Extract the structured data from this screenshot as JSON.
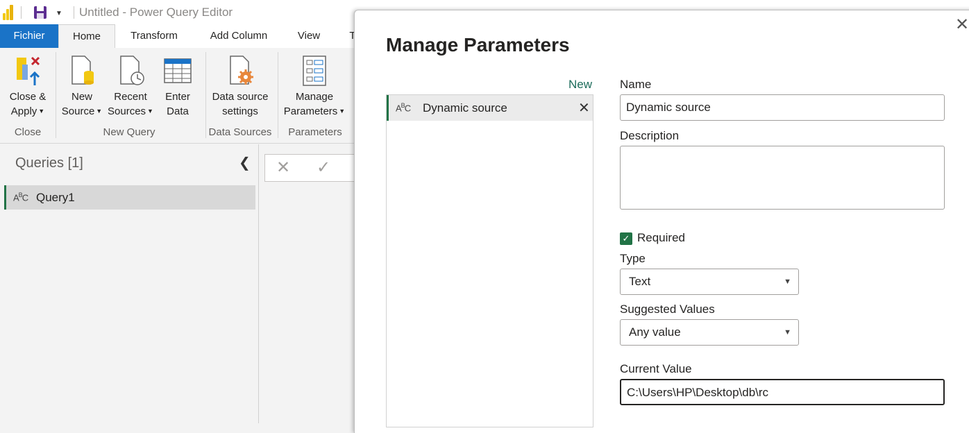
{
  "window": {
    "title": "Untitled - Power Query Editor"
  },
  "tabs": [
    {
      "label": "Fichier"
    },
    {
      "label": "Home"
    },
    {
      "label": "Transform"
    },
    {
      "label": "Add Column"
    },
    {
      "label": "View"
    },
    {
      "label": "T"
    }
  ],
  "ribbon": {
    "close_apply": {
      "line1": "Close &",
      "line2": "Apply"
    },
    "new_source": {
      "line1": "New",
      "line2": "Source"
    },
    "recent_sources": {
      "line1": "Recent",
      "line2": "Sources"
    },
    "enter_data": {
      "line1": "Enter",
      "line2": "Data"
    },
    "data_source_settings": {
      "line1": "Data source",
      "line2": "settings"
    },
    "manage_parameters": {
      "line1": "Manage",
      "line2": "Parameters"
    },
    "groups": {
      "close": "Close",
      "new_query": "New Query",
      "data_sources": "Data Sources",
      "parameters": "Parameters"
    }
  },
  "queries": {
    "title": "Queries [1]",
    "items": [
      {
        "name": "Query1",
        "type_icon": "abc-text-icon"
      }
    ]
  },
  "dialog": {
    "title": "Manage Parameters",
    "new_label": "New",
    "parameters": [
      {
        "name": "Dynamic source",
        "type_icon": "abc-text-icon"
      }
    ],
    "name_label": "Name",
    "name_value": "Dynamic source",
    "description_label": "Description",
    "description_value": "",
    "required_label": "Required",
    "required_checked": true,
    "type_label": "Type",
    "type_value": "Text",
    "suggested_values_label": "Suggested Values",
    "suggested_values_value": "Any value",
    "current_value_label": "Current Value",
    "current_value": "C:\\Users\\HP\\Desktop\\db\\rc"
  },
  "colors": {
    "accent_green": "#217346",
    "file_tab_blue": "#1a73c7",
    "link_teal": "#1b6b5a",
    "powerbi_yellow": "#f2c811"
  }
}
